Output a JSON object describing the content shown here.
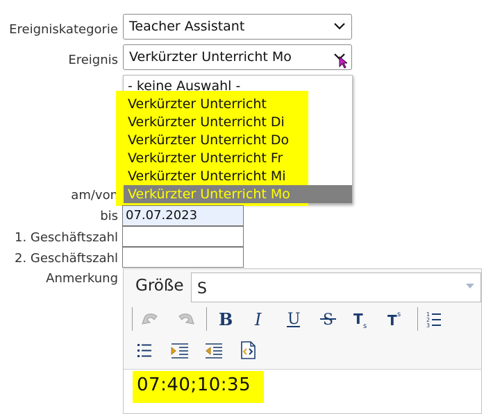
{
  "form": {
    "category_label": "Ereigniskategorie",
    "category_value": "Teacher Assistant",
    "event_label": "Ereignis",
    "event_value": "Verkürzter Unterricht Mo",
    "from_label": "am/von",
    "to_label": "bis",
    "to_value": "07.07.2023",
    "ref1_label": "1. Geschäftszahl",
    "ref1_value": "",
    "ref2_label": "2. Geschäftszahl",
    "ref2_value": "",
    "note_label": "Anmerkung"
  },
  "dropdown": {
    "options": [
      "- keine Auswahl -",
      "Verkürzter Unterricht",
      "Verkürzter Unterricht Di",
      "Verkürzter Unterricht Do",
      "Verkürzter Unterricht Fr",
      "Verkürzter Unterricht Mi",
      "Verkürzter Unterricht Mo"
    ],
    "selected_index": 6
  },
  "editor": {
    "size_label": "Größe",
    "size_value": "S",
    "content": "07:40;10:35"
  },
  "icons": {
    "undo": "undo-icon",
    "redo": "redo-icon",
    "bold": "bold-icon",
    "italic": "italic-icon",
    "underline": "underline-icon",
    "strike": "strikethrough-icon",
    "subscript": "subscript-icon",
    "superscript": "superscript-icon",
    "ordered_list": "numbered-list-icon",
    "bullet_list": "bulleted-list-icon",
    "indent": "indent-icon",
    "outdent": "outdent-icon",
    "source": "source-icon"
  },
  "colors": {
    "highlight": "#ffff00",
    "selected_bar": "#808080",
    "toolbar_icon": "#1a3c6e",
    "date_bg": "#e8f0fe"
  }
}
